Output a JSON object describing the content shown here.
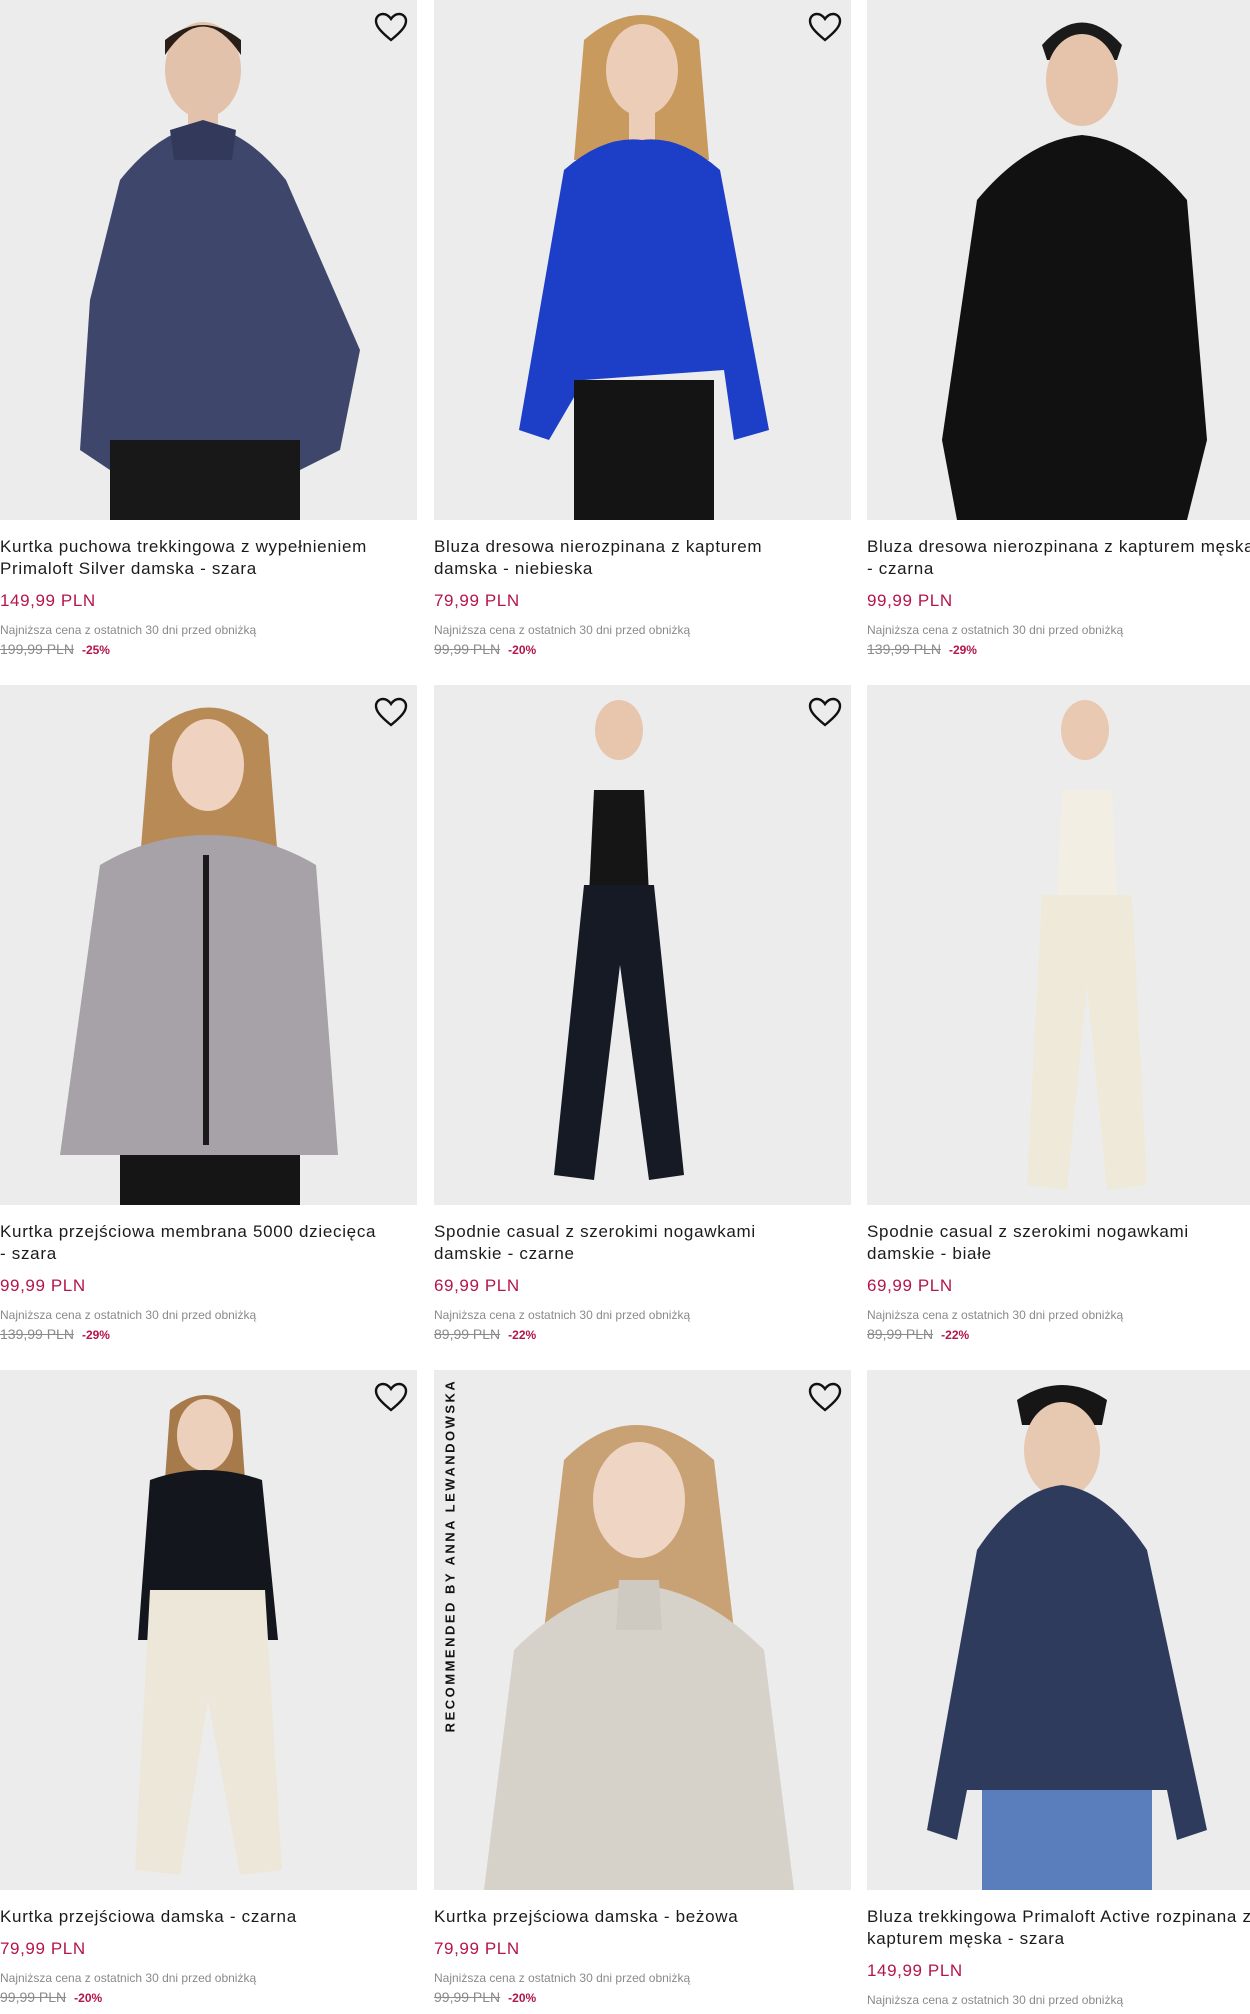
{
  "lowest_label": "Najniższa cena z ostatnich 30 dni przed obniżką",
  "badge_text": "RECOMMENDED BY ANNA LEWANDOWSKA",
  "products": [
    {
      "title_l1": "Kurtka puchowa trekkingowa z wypełnieniem",
      "title_l2": "Primaloft Silver damska - szara",
      "price": "149,99 PLN",
      "old_price": "199,99 PLN",
      "discount": "-25%"
    },
    {
      "title_l1": "Bluza dresowa nierozpinana z kapturem",
      "title_l2": "damska - niebieska",
      "price": "79,99 PLN",
      "old_price": "99,99 PLN",
      "discount": "-20%"
    },
    {
      "title_l1": "Bluza dresowa nierozpinana z kapturem męska",
      "title_l2": "- czarna",
      "price": "99,99 PLN",
      "old_price": "139,99 PLN",
      "discount": "-29%"
    },
    {
      "title_l1": "Kurtka przejściowa membrana 5000 dziecięca",
      "title_l2": "- szara",
      "price": "99,99 PLN",
      "old_price": "139,99 PLN",
      "discount": "-29%"
    },
    {
      "title_l1": "Spodnie casual z szerokimi nogawkami",
      "title_l2": "damskie - czarne",
      "price": "69,99 PLN",
      "old_price": "89,99 PLN",
      "discount": "-22%"
    },
    {
      "title_l1": "Spodnie casual z szerokimi nogawkami",
      "title_l2": "damskie - białe",
      "price": "69,99 PLN",
      "old_price": "89,99 PLN",
      "discount": "-22%"
    },
    {
      "title_l1": "Kurtka przejściowa damska - czarna",
      "title_l2": "",
      "price": "79,99 PLN",
      "old_price": "99,99 PLN",
      "discount": "-20%"
    },
    {
      "title_l1": "Kurtka przejściowa damska - beżowa",
      "title_l2": "",
      "price": "79,99 PLN",
      "old_price": "99,99 PLN",
      "discount": "-20%"
    },
    {
      "title_l1": "Bluza trekkingowa Primaloft Active rozpinana z",
      "title_l2": "kapturem męska - szara",
      "price": "149,99 PLN",
      "old_price": "",
      "discount": ""
    }
  ],
  "colors": {
    "price": "#b4154a",
    "muted": "#8a8a8a",
    "image_bg": "#ececec"
  },
  "icons": {
    "favorite": "heart-outline-icon"
  }
}
